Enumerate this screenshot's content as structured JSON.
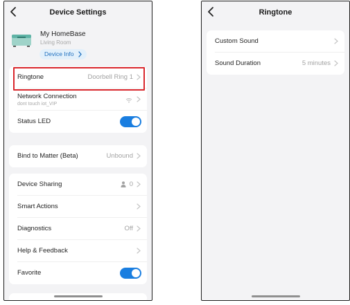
{
  "left_screen": {
    "title": "Device Settings",
    "device": {
      "name": "My HomeBase",
      "room": "Living Room",
      "info_button": "Device Info"
    },
    "rows": {
      "ringtone": {
        "label": "Ringtone",
        "value": "Doorbell Ring 1"
      },
      "network": {
        "label": "Network Connection",
        "sub": "dont touch iot_VIP"
      },
      "status_led": {
        "label": "Status LED",
        "toggle": "on"
      },
      "matter": {
        "label": "Bind to Matter (Beta)",
        "value": "Unbound"
      },
      "sharing": {
        "label": "Device Sharing",
        "value": "0"
      },
      "smart_actions": {
        "label": "Smart Actions"
      },
      "diagnostics": {
        "label": "Diagnostics",
        "value": "Off"
      },
      "help": {
        "label": "Help & Feedback"
      },
      "favorite": {
        "label": "Favorite",
        "toggle": "on"
      }
    }
  },
  "right_screen": {
    "title": "Ringtone",
    "rows": {
      "custom_sound": {
        "label": "Custom Sound"
      },
      "sound_duration": {
        "label": "Sound Duration",
        "value": "5 minutes"
      }
    }
  },
  "colors": {
    "accent": "#1a7ee0",
    "highlight": "#d9262c",
    "background": "#f3f3f5"
  }
}
